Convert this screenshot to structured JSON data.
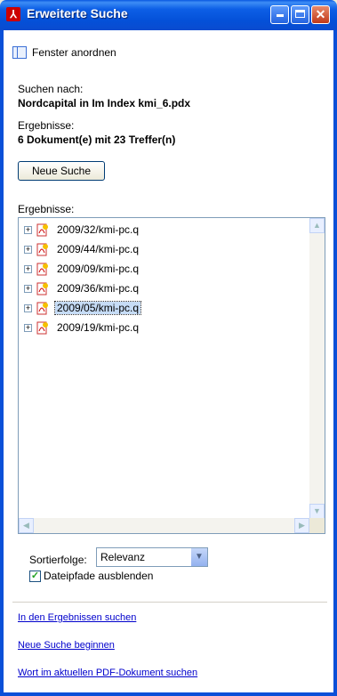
{
  "window": {
    "title": "Erweiterte Suche"
  },
  "toolbar": {
    "arrange_label": "Fenster anordnen"
  },
  "search": {
    "for_label": "Suchen nach:",
    "for_value": "Nordcapital in Im Index kmi_6.pdx",
    "results_label": "Ergebnisse:",
    "results_value": "6 Dokument(e) mit 23 Treffer(n)",
    "new_search_button": "Neue Suche"
  },
  "results": {
    "label": "Ergebnisse:",
    "items": [
      {
        "label": "2009/32/kmi-pc.q",
        "selected": false
      },
      {
        "label": "2009/44/kmi-pc.q",
        "selected": false
      },
      {
        "label": "2009/09/kmi-pc.q",
        "selected": false
      },
      {
        "label": "2009/36/kmi-pc.q",
        "selected": false
      },
      {
        "label": "2009/05/kmi-pc.q",
        "selected": true
      },
      {
        "label": "2009/19/kmi-pc.q",
        "selected": false
      }
    ]
  },
  "sort": {
    "label": "Sortierfolge:",
    "value": "Relevanz"
  },
  "options": {
    "hide_paths_label": "Dateipfade ausblenden",
    "hide_paths_checked": true
  },
  "links": {
    "search_in_results": "In den Ergebnissen suchen",
    "new_search": "Neue Suche beginnen",
    "search_current_pdf": "Wort im aktuellen PDF-Dokument suchen"
  }
}
